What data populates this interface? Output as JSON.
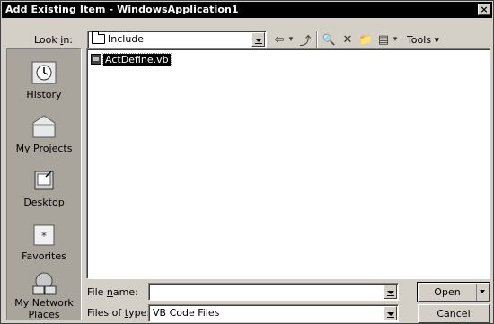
{
  "window": {
    "title": "Add Existing Item - WindowsApplication1",
    "close_glyph": "×"
  },
  "look_in": {
    "label": "Look in:",
    "value": "Include"
  },
  "toolbar": {
    "back_glyph": "⇦",
    "back_dd_glyph": "▾",
    "up_glyph": "⤴",
    "search_glyph": "🔍",
    "delete_glyph": "✕",
    "new_folder_glyph": "📁",
    "views_glyph": "▤",
    "views_dd_glyph": "▾",
    "tools_label": "Tools ▾"
  },
  "places": [
    {
      "label": "History",
      "icon": "history-icon"
    },
    {
      "label": "My Projects",
      "icon": "my-projects-icon"
    },
    {
      "label": "Desktop",
      "icon": "desktop-icon"
    },
    {
      "label": "Favorites",
      "icon": "favorites-icon"
    },
    {
      "label": "My Network Places",
      "icon": "network-places-icon"
    }
  ],
  "files": [
    {
      "name": "ActDefine.vb",
      "selected": true
    }
  ],
  "file_name": {
    "label": "File name:",
    "value": ""
  },
  "file_type": {
    "label": "Files of type:",
    "value": "VB Code Files"
  },
  "buttons": {
    "open": "Open",
    "cancel": "Cancel"
  }
}
